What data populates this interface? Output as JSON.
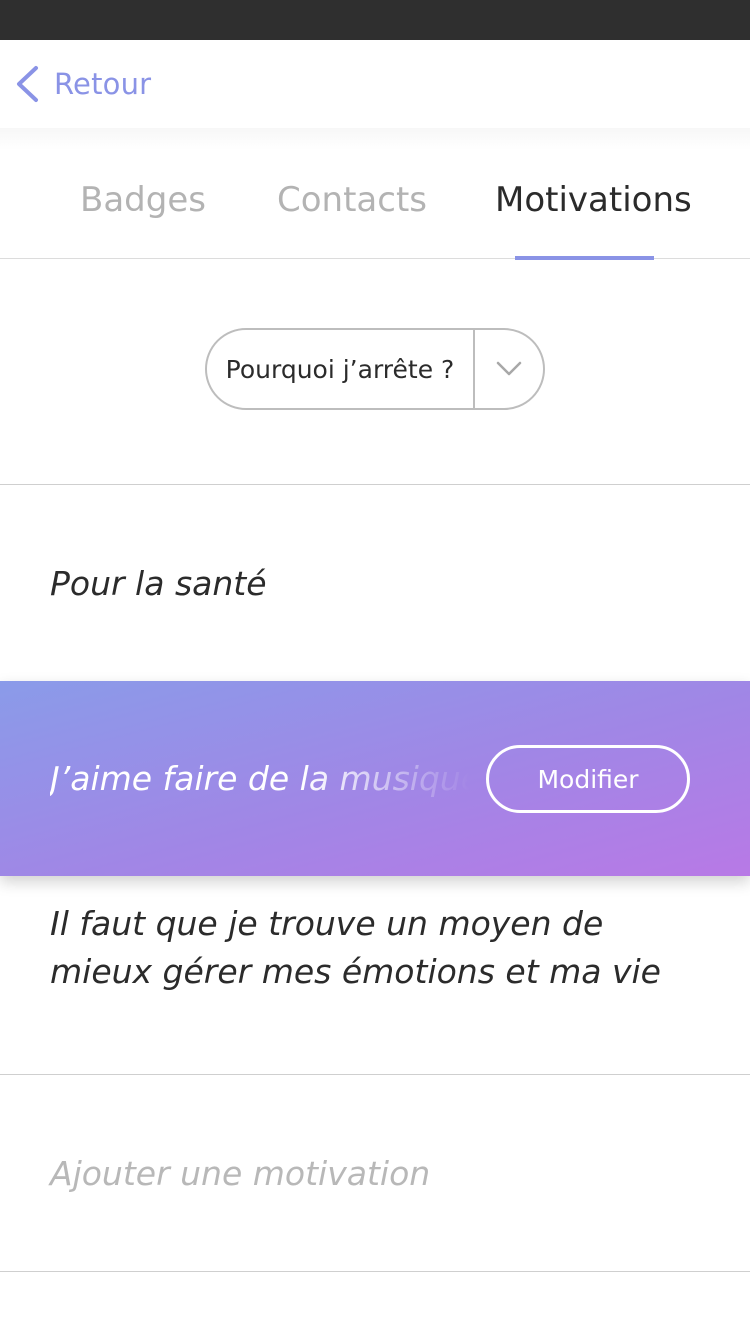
{
  "nav": {
    "back_label": "Retour"
  },
  "tabs": [
    {
      "label": "Badges",
      "active": false
    },
    {
      "label": "Contacts",
      "active": false
    },
    {
      "label": "Motivations",
      "active": true
    }
  ],
  "filter": {
    "selected": "Pourquoi j’arrête ?"
  },
  "motivations": [
    {
      "text": "Pour la santé",
      "selected": false
    },
    {
      "text": "J’aime faire de la musique ...",
      "selected": true,
      "action_label": "Modifier"
    },
    {
      "text": "Il faut que je trouve un moyen de mieux gérer mes émotions et ma vie",
      "selected": false
    }
  ],
  "add_placeholder": "Ajouter une motivation",
  "colors": {
    "accent": "#8a93e6",
    "selected_gradient_start": "#8a9be9",
    "selected_gradient_end": "#b879e6",
    "status_bar": "#2f2f2f"
  },
  "icons": {
    "back": "chevron-left-icon",
    "dropdown": "chevron-down-icon"
  }
}
